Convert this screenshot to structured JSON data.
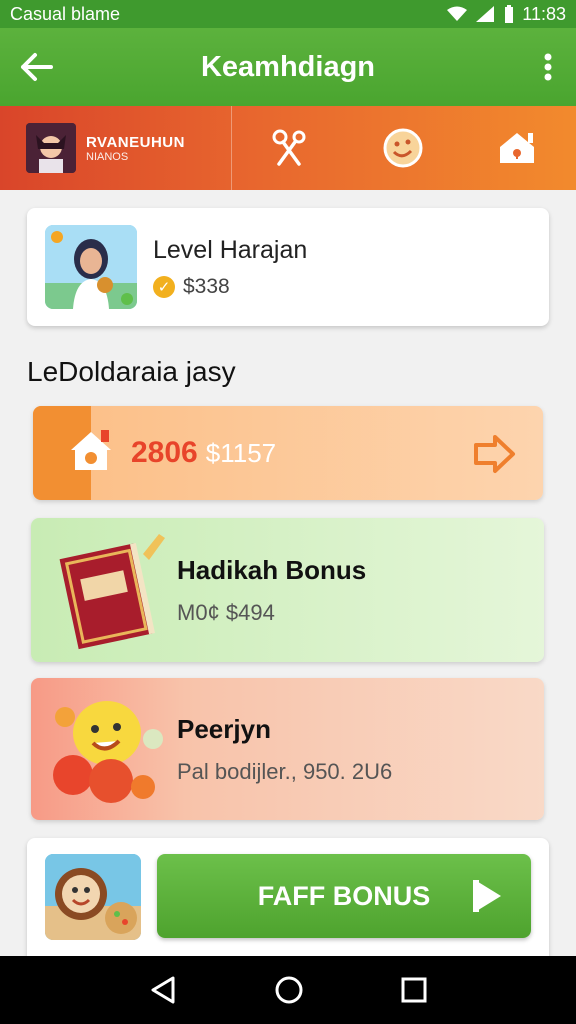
{
  "status_bar": {
    "title": "Casual blame",
    "time": "11:83"
  },
  "app_bar": {
    "title": "Keamhdiagn"
  },
  "category_strip": {
    "brand_line1": "RVANEUHUN",
    "brand_line2": "NIANOS"
  },
  "profile": {
    "name": "Level Harajan",
    "balance": "$338"
  },
  "section": {
    "heading": "LeDoldaraia jasy"
  },
  "points": {
    "value": "2806",
    "sub": "$1157"
  },
  "bonus_cards": [
    {
      "title": "Hadikah Bonus",
      "subtitle": "M0¢ $494"
    },
    {
      "title": "Peerjyn",
      "subtitle": "Pal bodijler., 950. 2U6"
    }
  ],
  "bottom": {
    "button_label": "FAFF BONUS"
  },
  "colors": {
    "primary_green": "#4aa52f",
    "accent_orange": "#f28f32",
    "accent_red": "#e8442a"
  },
  "icons": [
    "back-arrow-icon",
    "more-vert-icon",
    "wifi-icon",
    "signal-icon",
    "battery-icon",
    "scissors-icon",
    "smiley-icon",
    "house-icon",
    "arrow-right-icon",
    "play-icon",
    "nav-back-icon",
    "nav-home-icon",
    "nav-recents-icon"
  ]
}
